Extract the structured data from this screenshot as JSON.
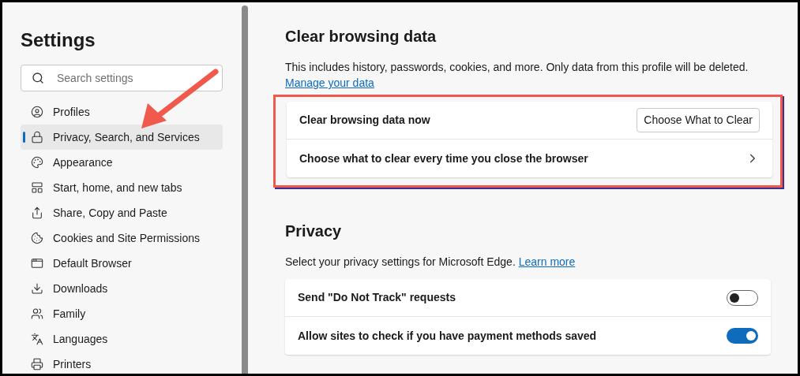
{
  "sidebar": {
    "title": "Settings",
    "search": {
      "placeholder": "Search settings"
    },
    "items": [
      {
        "label": "Profiles",
        "selected": false
      },
      {
        "label": "Privacy, Search, and Services",
        "selected": true
      },
      {
        "label": "Appearance",
        "selected": false
      },
      {
        "label": "Start, home, and new tabs",
        "selected": false
      },
      {
        "label": "Share, Copy and Paste",
        "selected": false
      },
      {
        "label": "Cookies and Site Permissions",
        "selected": false
      },
      {
        "label": "Default Browser",
        "selected": false
      },
      {
        "label": "Downloads",
        "selected": false
      },
      {
        "label": "Family",
        "selected": false
      },
      {
        "label": "Languages",
        "selected": false
      },
      {
        "label": "Printers",
        "selected": false
      }
    ]
  },
  "clear_browsing_data": {
    "title": "Clear browsing data",
    "description": "This includes history, passwords, cookies, and more. Only data from this profile will be deleted.",
    "link": "Manage your data",
    "highlighted": true,
    "rows": [
      {
        "kind": "button",
        "label": "Clear browsing data now",
        "button": "Choose What to Clear"
      },
      {
        "kind": "chevron",
        "label": "Choose what to clear every time you close the browser"
      }
    ]
  },
  "privacy": {
    "title": "Privacy",
    "description": "Select your privacy settings for Microsoft Edge.",
    "link": "Learn more",
    "rows": [
      {
        "kind": "toggle",
        "label": "Send \"Do Not Track\" requests",
        "on": false
      },
      {
        "kind": "toggle",
        "label": "Allow sites to check if you have payment methods saved",
        "on": true
      }
    ]
  }
}
